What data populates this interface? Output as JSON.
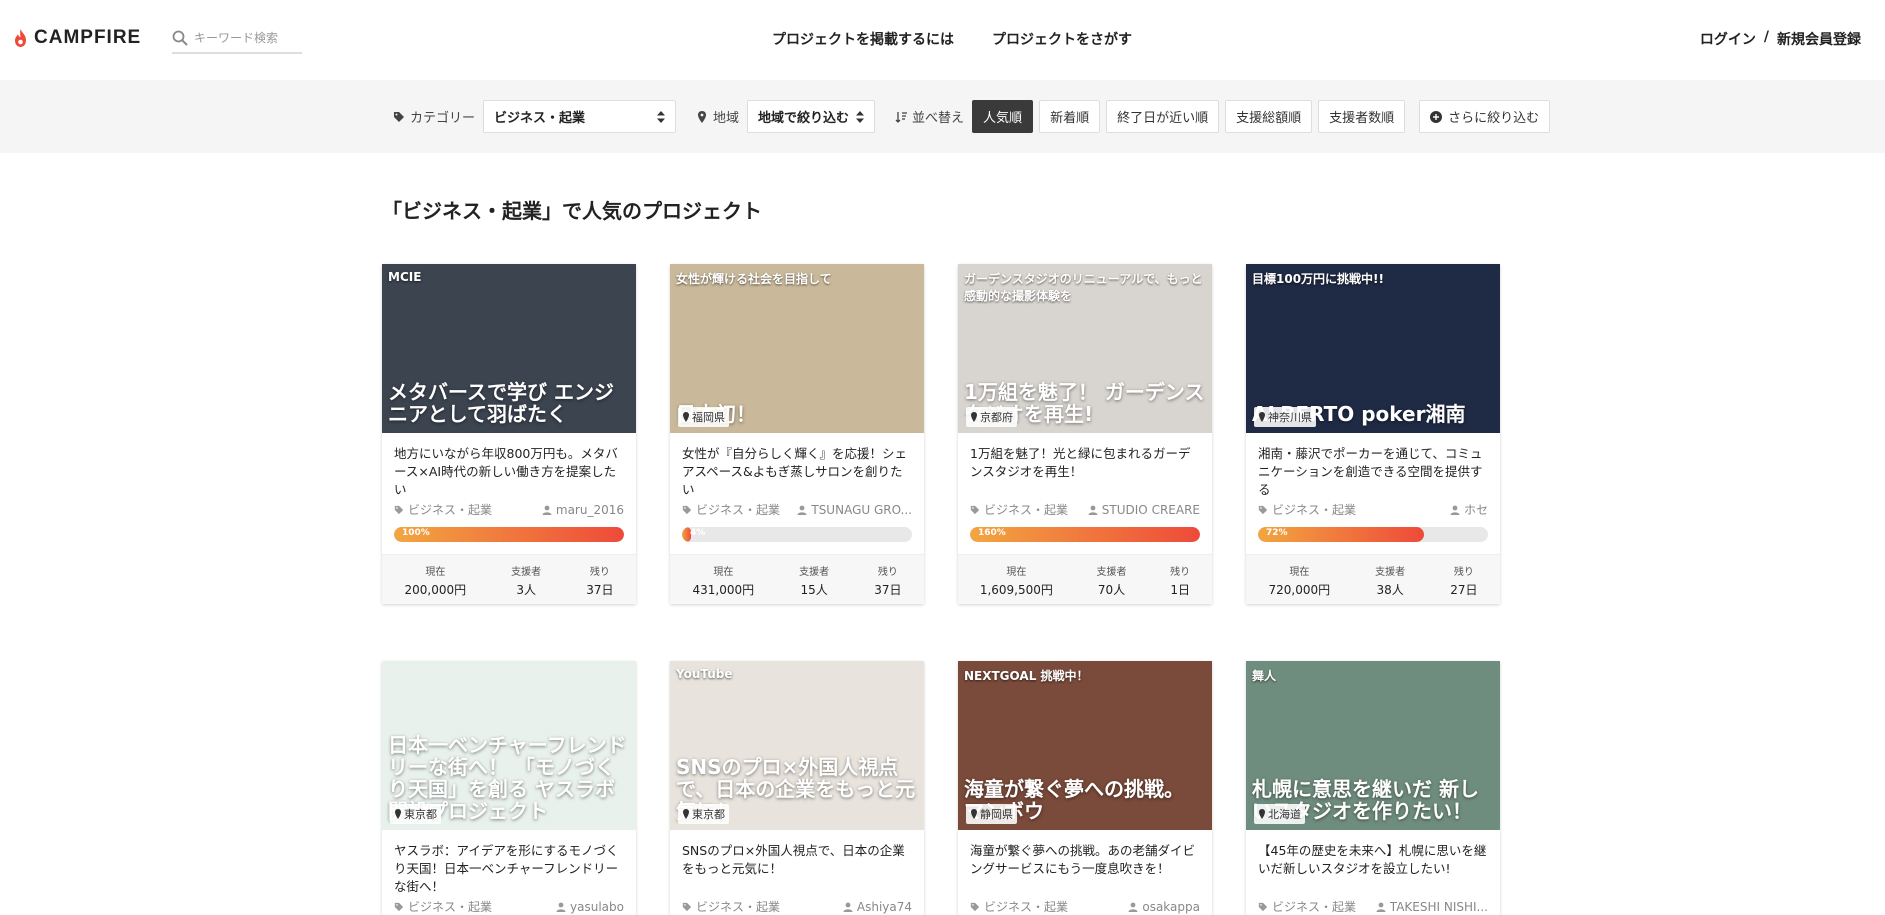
{
  "header": {
    "logo_text": "CAMPFIRE",
    "search_placeholder": "キーワード検索",
    "nav": [
      "プロジェクトを掲載するには",
      "プロジェクトをさがす"
    ],
    "login": "ログイン",
    "separator": "/",
    "register": "新規会員登録"
  },
  "filters": {
    "category_label": "カテゴリー",
    "category_value": "ビジネス・起業",
    "region_label": "地域",
    "region_value": "地域で絞り込む",
    "sort_label": "並べ替え",
    "sort_options": [
      "人気順",
      "新着順",
      "終了日が近い順",
      "支援総額順",
      "支援者数順"
    ],
    "active_sort": "人気順",
    "more_label": "さらに絞り込む"
  },
  "section_title": "「ビジネス・起業」で人気のプロジェクト",
  "stat_labels": {
    "current": "現在",
    "backers": "支援者",
    "remaining": "残り"
  },
  "colors": {
    "accent_start": "#f2a640",
    "accent_end": "#ee4a3a",
    "active_sort_bg": "#3a3a3a"
  },
  "cards": [
    {
      "thumb_text": "メタバースで学び エンジニアとして羽ばたく",
      "thumb_bg": "#3c4450",
      "thumb_overlay": "MCIE",
      "location": "",
      "title": "地方にいながら年収800万円も。メタバース×AI時代の新しい働き方を提案したい",
      "category": "ビジネス・起業",
      "owner": "maru_2016",
      "progress": 100,
      "progress_label": "100%",
      "current": "200,000円",
      "backers": "3人",
      "remaining": "37日"
    },
    {
      "thumb_text": "日本初！",
      "thumb_bg": "#c9b99a",
      "thumb_overlay": "女性が輝ける社会を目指して",
      "location": "福岡県",
      "title": "女性が『自分らしく輝く』を応援！シェアスペース&よもぎ蒸しサロンを創りたい",
      "category": "ビジネス・起業",
      "owner": "TSUNAGU GRO...",
      "progress": 4,
      "progress_label": "4%",
      "current": "431,000円",
      "backers": "15人",
      "remaining": "37日"
    },
    {
      "thumb_text": "1万組を魅了！ ガーデンスタジオを再生!",
      "thumb_bg": "#d8d4cf",
      "thumb_overlay": "ガーデンスタジオのリニューアルで、もっと感動的な撮影体験を",
      "location": "京都府",
      "title": "1万組を魅了！光と緑に包まれるガーデンスタジオを再生！",
      "category": "ビジネス・起業",
      "owner": "STUDIO CREARE",
      "progress": 100,
      "progress_label": "160%",
      "current": "1,609,500円",
      "backers": "70人",
      "remaining": "1日"
    },
    {
      "thumb_text": "ALBERTO poker湘南",
      "thumb_bg": "#1f2a45",
      "thumb_overlay": "目標100万円に挑戦中!!",
      "location": "神奈川県",
      "title": "湘南・藤沢でポーカーを通じて、コミュニケーションを創造できる空間を提供する",
      "category": "ビジネス・起業",
      "owner": "ホセ",
      "progress": 72,
      "progress_label": "72%",
      "current": "720,000円",
      "backers": "38人",
      "remaining": "27日"
    },
    {
      "thumb_text": "日本一ベンチャーフレンドリーな街へ！ 「モノづくり天国」を創る ヤスラボ開設プロジェクト",
      "thumb_bg": "#e9f1ec",
      "thumb_overlay": "",
      "location": "東京都",
      "title": "ヤスラボ：アイデアを形にするモノづくり天国！日本一ベンチャーフレンドリーな街へ！",
      "category": "ビジネス・起業",
      "owner": "yasulabo",
      "progress": 0,
      "progress_label": "",
      "current": "",
      "backers": "",
      "remaining": ""
    },
    {
      "thumb_text": "SNSのプロ×外国人視点で、日本の企業をもっと元気に！",
      "thumb_bg": "#e8e3dc",
      "thumb_overlay": "YouTube",
      "location": "東京都",
      "title": "SNSのプロ×外国人視点で、日本の企業をもっと元気に！",
      "category": "ビジネス・起業",
      "owner": "Ashiya74",
      "progress": 0,
      "progress_label": "",
      "current": "",
      "backers": "",
      "remaining": ""
    },
    {
      "thumb_text": "海童が繋ぐ夢への挑戦。 マンボウ",
      "thumb_bg": "#7a4a3a",
      "thumb_overlay": "NEXTGOAL 挑戦中！",
      "location": "静岡県",
      "title": "海童が繋ぐ夢への挑戦。あの老舗ダイビングサービスにもう一度息吹きを！",
      "category": "ビジネス・起業",
      "owner": "osakappa",
      "progress": 0,
      "progress_label": "",
      "current": "",
      "backers": "",
      "remaining": ""
    },
    {
      "thumb_text": "札幌に意思を継いだ 新しいスタジオを作りたい！",
      "thumb_bg": "#6f8d7e",
      "thumb_overlay": "舞人",
      "location": "北海道",
      "title": "【45年の歴史を未来へ】札幌に思いを継いだ新しいスタジオを設立したい!",
      "category": "ビジネス・起業",
      "owner": "TAKESHI NISHI...",
      "progress": 0,
      "progress_label": "",
      "current": "",
      "backers": "",
      "remaining": ""
    }
  ]
}
